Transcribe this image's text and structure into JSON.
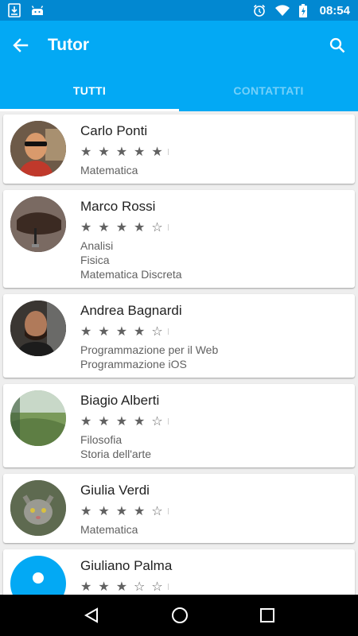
{
  "status_bar": {
    "time": "08:54",
    "icons": [
      "download-icon",
      "android-icon",
      "alarm-icon",
      "wifi-icon",
      "battery-charging-icon"
    ]
  },
  "app_bar": {
    "title": "Tutor",
    "back_icon": "arrow-back-icon",
    "search_icon": "search-icon"
  },
  "tabs": [
    {
      "label": "TUTTI",
      "active": true
    },
    {
      "label": "CONTATTATI",
      "active": false
    }
  ],
  "tutors": [
    {
      "name": "Carlo Ponti",
      "rating": 5,
      "subjects": [
        "Matematica"
      ],
      "avatar": "photo-man-sunglasses",
      "bg": "#5a4a3a"
    },
    {
      "name": "Marco Rossi",
      "rating": 4,
      "subjects": [
        "Analisi",
        "Fisica",
        "Matematica Discreta"
      ],
      "avatar": "photo-saddle",
      "bg": "#3e3230"
    },
    {
      "name": "Andrea Bagnardi",
      "rating": 4,
      "subjects": [
        "Programmazione per il Web",
        "Programmazione iOS"
      ],
      "avatar": "photo-man-beard",
      "bg": "#2c2a28"
    },
    {
      "name": "Biagio Alberti",
      "rating": 4,
      "subjects": [
        "Filosofia",
        "Storia dell'arte"
      ],
      "avatar": "photo-landscape",
      "bg": "#8fa88a"
    },
    {
      "name": "Giulia Verdi",
      "rating": 4,
      "subjects": [
        "Matematica"
      ],
      "avatar": "photo-cat",
      "bg": "#6b6b60"
    },
    {
      "name": "Giuliano Palma",
      "rating": 3,
      "subjects": [],
      "avatar": "default-avatar",
      "bg": "#03a9f4"
    }
  ],
  "nav_bar": {
    "icons": [
      "back-triangle-icon",
      "home-circle-icon",
      "recents-square-icon"
    ]
  }
}
